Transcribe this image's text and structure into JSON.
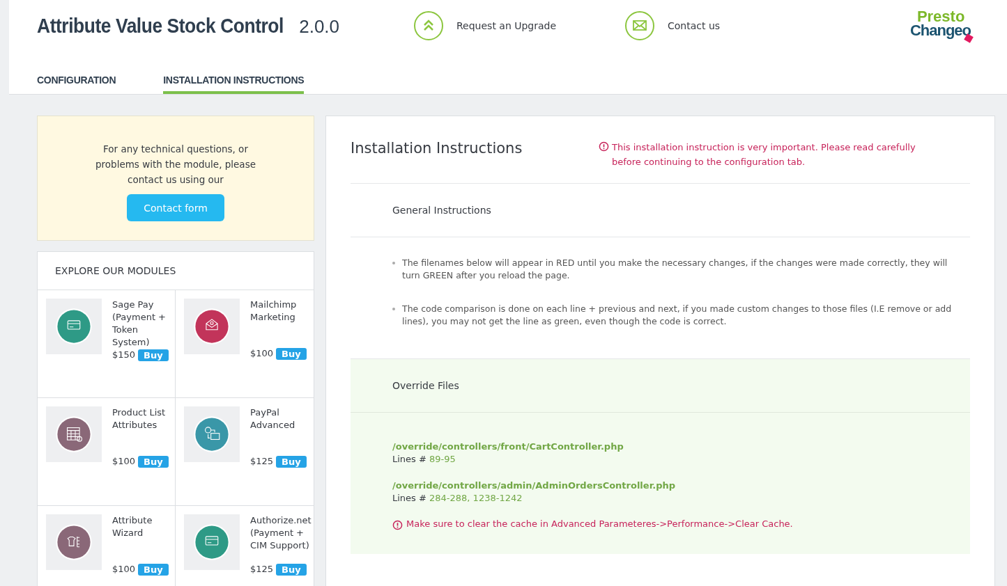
{
  "header": {
    "title": "Attribute Value Stock Control",
    "version": "2.0.0",
    "links": [
      {
        "kind": "upgrade",
        "label": "Request an Upgrade"
      },
      {
        "kind": "contact",
        "label": "Contact us"
      }
    ],
    "logo": {
      "line_1": "Presto",
      "line_2": "Changeo"
    }
  },
  "tabs": [
    {
      "label": "CONFIGURATION",
      "selected": false
    },
    {
      "label": "INSTALLATION INSTRUCTIONS",
      "selected": true
    }
  ],
  "support": {
    "text": "For any technical questions, or problems with the module, please contact us using our",
    "button": "Contact form"
  },
  "modules": {
    "title": "EXPLORE OUR MODULES",
    "items": [
      {
        "name": "Sage Pay (Payment + Token System)",
        "price": "$150",
        "buy": "Buy",
        "color": "#2e9a86",
        "kind": "card"
      },
      {
        "name": "Mailchimp Marketing",
        "price": "$100",
        "buy": "Buy",
        "color": "#c2345a",
        "kind": "mail"
      },
      {
        "name": "Product List Attributes",
        "price": "$100",
        "buy": "Buy",
        "color": "#8a6878",
        "kind": "grid"
      },
      {
        "name": "PayPal Advanced",
        "price": "$125",
        "buy": "Buy",
        "color": "#3a97a8",
        "kind": "transfer"
      },
      {
        "name": "Attribute Wizard",
        "price": "$100",
        "buy": "Buy",
        "color": "#8a6878",
        "kind": "tree"
      },
      {
        "name": "Authorize.net (Payment + CIM Support)",
        "price": "$125",
        "buy": "Buy",
        "color": "#2e9a86",
        "kind": "card"
      }
    ]
  },
  "instructions": {
    "title": "Installation Instructions",
    "warning": "This installation instruction is very important. Please read carefully before continuing to the configuration tab.",
    "general": {
      "title": "General Instructions",
      "bullets": [
        "The filenames below will appear in RED until you make the necessary changes, if the changes were made correctly, they will turn GREEN after you reload the page.",
        "The code comparison is done on each line + previous and next, if you made custom changes to those files (I.E remove or add lines), you may not get the line as green, even though the code is correct."
      ]
    },
    "overrides": {
      "title": "Override Files",
      "files": [
        {
          "path": "/override/controllers/front/CartController.php",
          "lines_label": "Lines #",
          "lines": "89-95"
        },
        {
          "path": "/override/controllers/admin/AdminOrdersController.php",
          "lines_label": "Lines #",
          "lines": "284-288, 1238-1242"
        }
      ],
      "note": "Make sure to clear the cache in Advanced Parameteres->Performance->Clear Cache."
    }
  }
}
